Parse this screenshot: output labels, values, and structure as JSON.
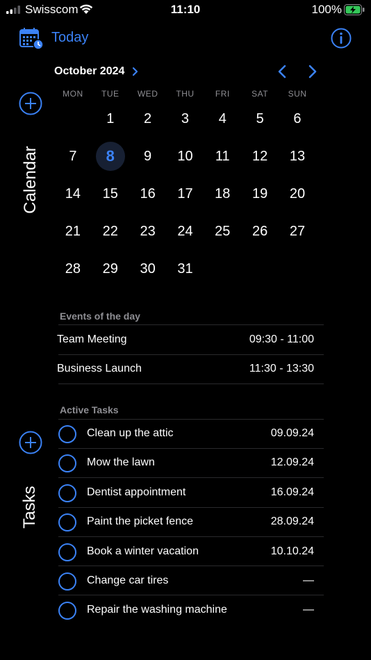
{
  "status_bar": {
    "carrier": "Swisscom",
    "time": "11:10",
    "battery": "100%"
  },
  "nav": {
    "today_label": "Today"
  },
  "side": {
    "calendar_label": "Calendar",
    "tasks_label": "Tasks"
  },
  "calendar": {
    "month_title": "October 2024",
    "weekdays": [
      "MON",
      "TUE",
      "WED",
      "THU",
      "FRI",
      "SAT",
      "SUN"
    ],
    "first_weekday_offset": 1,
    "days_in_month": 31,
    "selected_day": 8
  },
  "events": {
    "title": "Events of the day",
    "items": [
      {
        "name": "Team Meeting",
        "time": "09:30 - 11:00"
      },
      {
        "name": "Business Launch",
        "time": "11:30 - 13:30"
      }
    ]
  },
  "tasks": {
    "title": "Active Tasks",
    "items": [
      {
        "name": "Clean up the attic",
        "date": "09.09.24"
      },
      {
        "name": "Mow the lawn",
        "date": "12.09.24"
      },
      {
        "name": "Dentist appointment",
        "date": "16.09.24"
      },
      {
        "name": "Paint the picket fence",
        "date": "28.09.24"
      },
      {
        "name": "Book a winter vacation",
        "date": "10.10.24"
      },
      {
        "name": "Change car tires",
        "date": "—"
      },
      {
        "name": "Repair the washing machine",
        "date": "—"
      }
    ]
  },
  "colors": {
    "accent": "#3b82f6",
    "background": "#000000",
    "secondary_text": "#8e8e93",
    "today_highlight": "#172033",
    "battery_charge": "#34c759"
  },
  "icons": {
    "signal": "cellular-signal-icon",
    "wifi": "wifi-icon",
    "battery": "battery-charging-icon",
    "calendar": "calendar-clock-icon",
    "info": "info-circle-icon",
    "add": "plus-circle-icon",
    "chevron": "chevron-right-icon",
    "prev": "chevron-left-icon",
    "next": "chevron-right-icon",
    "task": "empty-circle-icon"
  }
}
